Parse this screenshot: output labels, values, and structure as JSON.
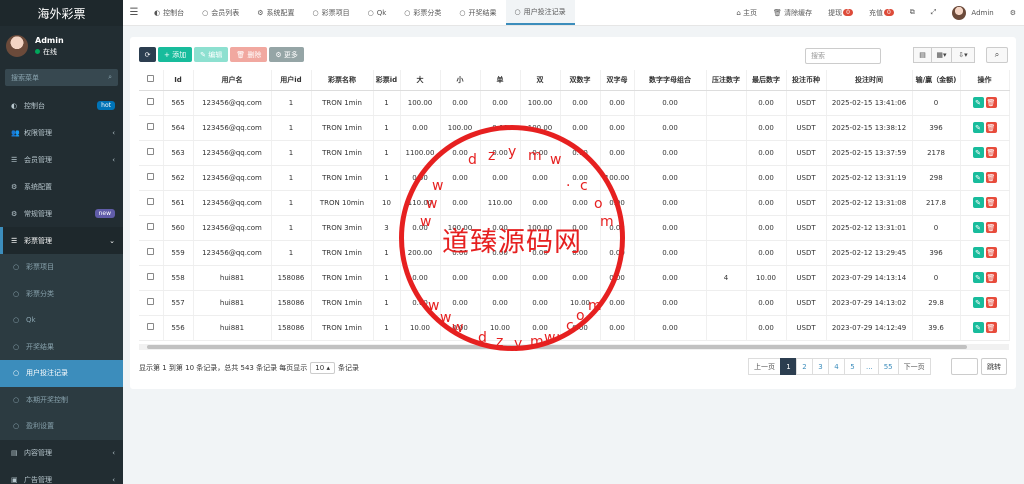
{
  "sidebar": {
    "brand": "海外彩票",
    "user": {
      "name": "Admin",
      "status": "在线"
    },
    "search_placeholder": "搜索菜单",
    "items": [
      {
        "label": "控制台",
        "icon": "dashboard-icon",
        "badge": "hot",
        "badge_color": "blue"
      },
      {
        "label": "权限管理",
        "icon": "group-icon",
        "chevron": "‹"
      },
      {
        "label": "会员管理",
        "icon": "user-icon",
        "chevron": "‹"
      },
      {
        "label": "系统配置",
        "icon": "gear-icon"
      },
      {
        "label": "常规管理",
        "icon": "gears-icon",
        "badge": "new",
        "badge_color": "purple"
      },
      {
        "label": "彩票管理",
        "icon": "list-icon",
        "chevron": "⌄",
        "open": true
      },
      {
        "label": "彩票项目",
        "sub": true
      },
      {
        "label": "彩票分类",
        "sub": true
      },
      {
        "label": "Qk",
        "sub": true
      },
      {
        "label": "开奖结果",
        "sub": true
      },
      {
        "label": "用户投注记录",
        "sub": true,
        "active": true
      },
      {
        "label": "本期开奖控制",
        "sub": true
      },
      {
        "label": "盈利设置",
        "sub": true
      },
      {
        "label": "内容管理",
        "icon": "file-icon",
        "chevron": "‹"
      },
      {
        "label": "广告管理",
        "icon": "image-icon",
        "chevron": "‹"
      }
    ]
  },
  "topbar": {
    "tabs": [
      {
        "label": "控制台",
        "icon": "dashboard-icon"
      },
      {
        "label": "会员列表",
        "icon": "circle-icon"
      },
      {
        "label": "系统配置",
        "icon": "gear-icon"
      },
      {
        "label": "彩票项目",
        "icon": "circle-icon"
      },
      {
        "label": "Qk",
        "icon": "circle-icon"
      },
      {
        "label": "彩票分类",
        "icon": "circle-icon"
      },
      {
        "label": "开奖结果",
        "icon": "circle-icon"
      },
      {
        "label": "用户投注记录",
        "icon": "circle-icon",
        "active": true
      }
    ],
    "home": "主页",
    "clear_cache": "清除缓存",
    "withdraw": "提现",
    "withdraw_count": "0",
    "recharge": "充值",
    "recharge_count": "0",
    "admin": "Admin"
  },
  "toolbar": {
    "add_label": "添加",
    "edit_label": "编辑",
    "delete_label": "删除",
    "more_label": "更多",
    "search_placeholder": "搜索"
  },
  "table": {
    "columns": [
      "Id",
      "用户名",
      "用户id",
      "彩票名称",
      "彩票id",
      "大",
      "小",
      "单",
      "双",
      "双数字",
      "双字母",
      "数字字母组合",
      "压注数字",
      "最后数字",
      "投注币种",
      "投注时间",
      "输/赢（金额)",
      "操作"
    ],
    "rows": [
      [
        "565",
        "123456@qq.com",
        "1",
        "TRON 1min",
        "1",
        "100.00",
        "0.00",
        "0.00",
        "100.00",
        "0.00",
        "0.00",
        "0.00",
        "",
        "0.00",
        "USDT",
        "2025-02-15 13:41:06",
        "0"
      ],
      [
        "564",
        "123456@qq.com",
        "1",
        "TRON 1min",
        "1",
        "0.00",
        "100.00",
        "0.00",
        "100.00",
        "0.00",
        "0.00",
        "0.00",
        "",
        "0.00",
        "USDT",
        "2025-02-15 13:38:12",
        "396"
      ],
      [
        "563",
        "123456@qq.com",
        "1",
        "TRON 1min",
        "1",
        "1100.00",
        "0.00",
        "0.00",
        "0.00",
        "0.00",
        "0.00",
        "0.00",
        "",
        "0.00",
        "USDT",
        "2025-02-15 13:37:59",
        "2178"
      ],
      [
        "562",
        "123456@qq.com",
        "1",
        "TRON 1min",
        "1",
        "0.00",
        "0.00",
        "0.00",
        "0.00",
        "0.00",
        "100.00",
        "0.00",
        "",
        "0.00",
        "USDT",
        "2025-02-12 13:31:19",
        "298"
      ],
      [
        "561",
        "123456@qq.com",
        "1",
        "TRON 10min",
        "10",
        "110.00",
        "0.00",
        "110.00",
        "0.00",
        "0.00",
        "0.00",
        "0.00",
        "",
        "0.00",
        "USDT",
        "2025-02-12 13:31:08",
        "217.8"
      ],
      [
        "560",
        "123456@qq.com",
        "1",
        "TRON 3min",
        "3",
        "0.00",
        "100.00",
        "0.00",
        "100.00",
        "0.00",
        "0.00",
        "0.00",
        "",
        "0.00",
        "USDT",
        "2025-02-12 13:31:01",
        "0"
      ],
      [
        "559",
        "123456@qq.com",
        "1",
        "TRON 1min",
        "1",
        "200.00",
        "0.00",
        "0.00",
        "0.00",
        "0.00",
        "0.00",
        "0.00",
        "",
        "0.00",
        "USDT",
        "2025-02-12 13:29:45",
        "396"
      ],
      [
        "558",
        "hui881",
        "158086",
        "TRON 1min",
        "1",
        "0.00",
        "0.00",
        "0.00",
        "0.00",
        "0.00",
        "0.00",
        "0.00",
        "4",
        "10.00",
        "USDT",
        "2023-07-29 14:13:14",
        "0"
      ],
      [
        "557",
        "hui881",
        "158086",
        "TRON 1min",
        "1",
        "0.00",
        "0.00",
        "0.00",
        "0.00",
        "10.00",
        "0.00",
        "0.00",
        "",
        "0.00",
        "USDT",
        "2023-07-29 14:13:02",
        "29.8"
      ],
      [
        "556",
        "hui881",
        "158086",
        "TRON 1min",
        "1",
        "10.00",
        "0.00",
        "10.00",
        "0.00",
        "0.00",
        "0.00",
        "0.00",
        "",
        "0.00",
        "USDT",
        "2023-07-29 14:12:49",
        "39.6"
      ]
    ]
  },
  "pager": {
    "info_prefix": "显示第 1 到第 10 条记录，总共 543 条记录 每页显示",
    "page_size": "10",
    "info_suffix": "条记录",
    "prev": "上一页",
    "pages": [
      "1",
      "2",
      "3",
      "4",
      "5",
      "...",
      "55"
    ],
    "current": "1",
    "next": "下一页",
    "jump": "跳转"
  },
  "watermark": {
    "text": "道臻源码网",
    "chars_top": [
      "d",
      "z",
      "y",
      "m",
      "w"
    ],
    "chars_left": [
      "w",
      "w",
      "w"
    ],
    "chars_right": [
      ".",
      "c",
      "o",
      "m"
    ],
    "chars_bottom": [
      "d",
      "z",
      "y",
      "m",
      "w",
      ".",
      "c",
      "o",
      "m"
    ],
    "chars_bottom_left": [
      "w",
      "w",
      "w"
    ]
  }
}
